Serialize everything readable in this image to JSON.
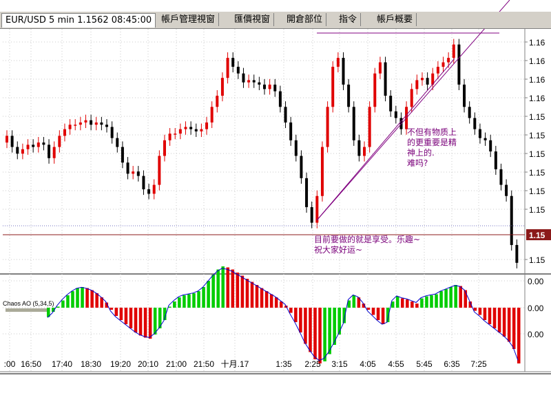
{
  "tabs": [
    {
      "label": "EUR/USD 5 min 1.1562 08:45:00",
      "active": true
    },
    {
      "label": "帳戶管理視窗"
    },
    {
      "label": "匯價視窗"
    },
    {
      "label": "開倉部位"
    },
    {
      "label": "指令"
    },
    {
      "label": "帳戶概要"
    }
  ],
  "colors": {
    "up": "#e00000",
    "down": "#000000",
    "ao_up": "#00cc00",
    "ao_down": "#e00000",
    "annotation": "#7a007a",
    "price_line": "#8b1a1a"
  },
  "chart_data": [
    {
      "type": "candlestick",
      "title": "EUR/USD 5 min 1.1562 08:45:00",
      "y_tick_labels": [
        "1.16",
        "1.16",
        "1.16",
        "1.16",
        "1.15",
        "1.15",
        "1.15",
        "1.15",
        "1.15",
        "1.15",
        "1.15"
      ],
      "current_price_label": "1.15",
      "x_tick_labels": [
        ":00",
        "16:50",
        "17:40",
        "18:30",
        "19:20",
        "20:10",
        "21:00",
        "21:50",
        "十月.17",
        "1:35",
        "2:25",
        "3:15",
        "4:05",
        "4:55",
        "5:45",
        "6:35",
        "7:25"
      ],
      "closes": [
        1.1577,
        1.1572,
        1.1569,
        1.1571,
        1.1573,
        1.1572,
        1.1574,
        1.1573,
        1.1567,
        1.1572,
        1.1577,
        1.158,
        1.1582,
        1.1582,
        1.1583,
        1.1584,
        1.1582,
        1.1583,
        1.1582,
        1.1581,
        1.1576,
        1.1572,
        1.1565,
        1.156,
        1.1561,
        1.1559,
        1.1553,
        1.1551,
        1.1555,
        1.1568,
        1.1575,
        1.1578,
        1.1578,
        1.158,
        1.1581,
        1.158,
        1.1579,
        1.158,
        1.1583,
        1.159,
        1.1595,
        1.1603,
        1.1612,
        1.1608,
        1.1605,
        1.1601,
        1.1602,
        1.1601,
        1.16,
        1.1598,
        1.16,
        1.1597,
        1.159,
        1.1583,
        1.1575,
        1.1568,
        1.1558,
        1.1545,
        1.1538,
        1.155,
        1.1572,
        1.159,
        1.1608,
        1.1612,
        1.16,
        1.159,
        1.1575,
        1.1568,
        1.1572,
        1.159,
        1.1605,
        1.161,
        1.1595,
        1.1588,
        1.1585,
        1.158,
        1.159,
        1.1598,
        1.1602,
        1.1603,
        1.16,
        1.1605,
        1.1608,
        1.161,
        1.1612,
        1.1618,
        1.16,
        1.159,
        1.1585,
        1.158,
        1.1576,
        1.1575,
        1.157,
        1.1562,
        1.1555,
        1.155,
        1.1528,
        1.152
      ],
      "annotations": [
        "不但有物质上\n的更重要是精\n神上的.\n难吗?",
        "目前要做的就是享受。乐趣~\n祝大家好运~"
      ]
    },
    {
      "type": "bar",
      "indicator_label": "Chaos AO (5,34,5)",
      "y_tick_labels": [
        "0.00",
        "0.00",
        "0.00"
      ],
      "values": [
        -9e-05,
        -4e-05,
        1e-05,
        7e-05,
        0.00012,
        0.00016,
        0.00019,
        0.0002,
        0.00019,
        0.00017,
        0.00014,
        0.0001,
        5e-05,
        -2e-05,
        -8e-05,
        -0.00012,
        -0.00016,
        -0.0002,
        -0.00024,
        -0.00027,
        -0.00029,
        -0.0003,
        -0.00026,
        -0.0002,
        -0.00012,
        1e-05,
        6e-05,
        0.0001,
        0.00012,
        0.00013,
        0.00014,
        0.00016,
        0.0002,
        0.00026,
        0.00032,
        0.00037,
        0.0004,
        0.00039,
        0.00037,
        0.00034,
        0.00031,
        0.00028,
        0.00025,
        0.00022,
        0.00019,
        0.00016,
        0.00013,
        0.0001,
        6e-05,
        2e-05,
        -5e-05,
        -0.00014,
        -0.00024,
        -0.00035,
        -0.00043,
        -0.0005,
        -0.00054,
        -0.00052,
        -0.00045,
        -0.00036,
        -0.00026,
        -0.00015,
        7e-05,
        0.00012,
        0.0001,
        4e-05,
        -2e-05,
        -7e-05,
        -0.00012,
        -0.00016,
        -0.00014,
        6e-05,
        0.00011,
        9e-05,
        8e-05,
        6e-05,
        4e-05,
        9e-05,
        0.00011,
        0.00012,
        0.00013,
        0.00016,
        0.00018,
        0.0002,
        0.00022,
        0.00021,
        0.00017,
        6e-05,
        -3e-05,
        -7e-05,
        -0.00012,
        -0.00016,
        -0.0002,
        -0.00024,
        -0.00028,
        -0.00033,
        -0.0004,
        -0.00054
      ]
    }
  ]
}
